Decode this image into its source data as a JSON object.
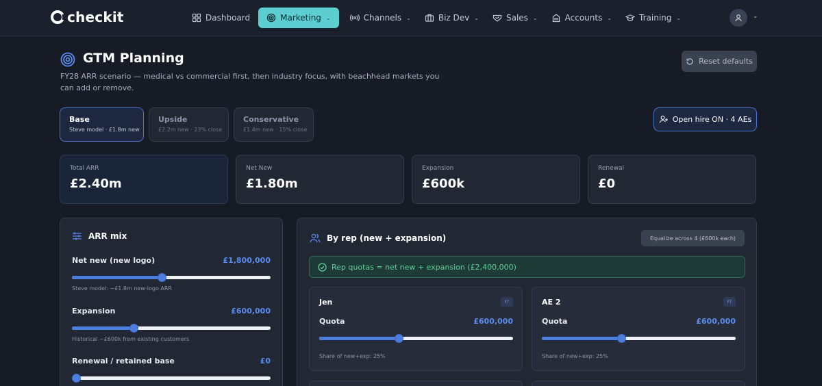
{
  "app": {
    "name": "checkit"
  },
  "nav": {
    "items": [
      {
        "label": "Dashboard",
        "icon": "grid-icon",
        "active": false,
        "dropdown": false
      },
      {
        "label": "Marketing",
        "icon": "target-icon",
        "active": true,
        "dropdown": true
      },
      {
        "label": "Channels",
        "icon": "broadcast-icon",
        "active": false,
        "dropdown": true
      },
      {
        "label": "Biz Dev",
        "icon": "briefcase-icon",
        "active": false,
        "dropdown": true
      },
      {
        "label": "Sales",
        "icon": "handshake-icon",
        "active": false,
        "dropdown": true
      },
      {
        "label": "Accounts",
        "icon": "building-icon",
        "active": false,
        "dropdown": true
      },
      {
        "label": "Training",
        "icon": "graduation-cap-icon",
        "active": false,
        "dropdown": true
      }
    ]
  },
  "header": {
    "title": "GTM Planning",
    "subtitle": "FY28 ARR scenario — medical vs commercial first, then industry focus, with beachhead markets you can add or remove.",
    "reset_label": "Reset defaults"
  },
  "scenarios": [
    {
      "name": "Base",
      "desc": "Steve model · £1.8m new",
      "active": true
    },
    {
      "name": "Upside",
      "desc": "£2.2m new · 23% close",
      "active": false
    },
    {
      "name": "Conservative",
      "desc": "£1.4m new · 15% close",
      "active": false
    }
  ],
  "hire_button": {
    "label": "Open hire ON · 4 AEs"
  },
  "kpis": [
    {
      "label": "Total ARR",
      "value": "£2.40m"
    },
    {
      "label": "Net New",
      "value": "£1.80m"
    },
    {
      "label": "Expansion",
      "value": "£600k"
    },
    {
      "label": "Renewal",
      "value": "£0"
    }
  ],
  "arr_mix": {
    "title": "ARR mix",
    "rows": [
      {
        "label": "Net new (new logo)",
        "amount": "£1,800,000",
        "note": "Steve model: ~£1.8m new-logo ARR",
        "fraction": 0.45
      },
      {
        "label": "Expansion",
        "amount": "£600,000",
        "note": "Historical ~£600k from existing customers",
        "fraction": 0.31
      },
      {
        "label": "Renewal / retained base",
        "amount": "£0",
        "note": "",
        "fraction": 0.02
      }
    ]
  },
  "by_rep": {
    "title": "By rep (new + expansion)",
    "equalize_label": "Equalize across 4 (£600k each)",
    "banner": "Rep quotas = net new + expansion (£2,400,000)",
    "reps": [
      {
        "name": "Jen",
        "badge": "FT",
        "quota_label": "Quota",
        "quota": "£600,000",
        "share": "Share of new+exp: 25%",
        "fraction": 0.41
      },
      {
        "name": "AE 2",
        "badge": "FT",
        "quota_label": "Quota",
        "quota": "£600,000",
        "share": "Share of new+exp: 25%",
        "fraction": 0.41
      }
    ]
  },
  "colors": {
    "accent": "#5ccdd1",
    "primary": "#4c7ee0",
    "success": "#5fd19b",
    "background": "#161b26"
  }
}
